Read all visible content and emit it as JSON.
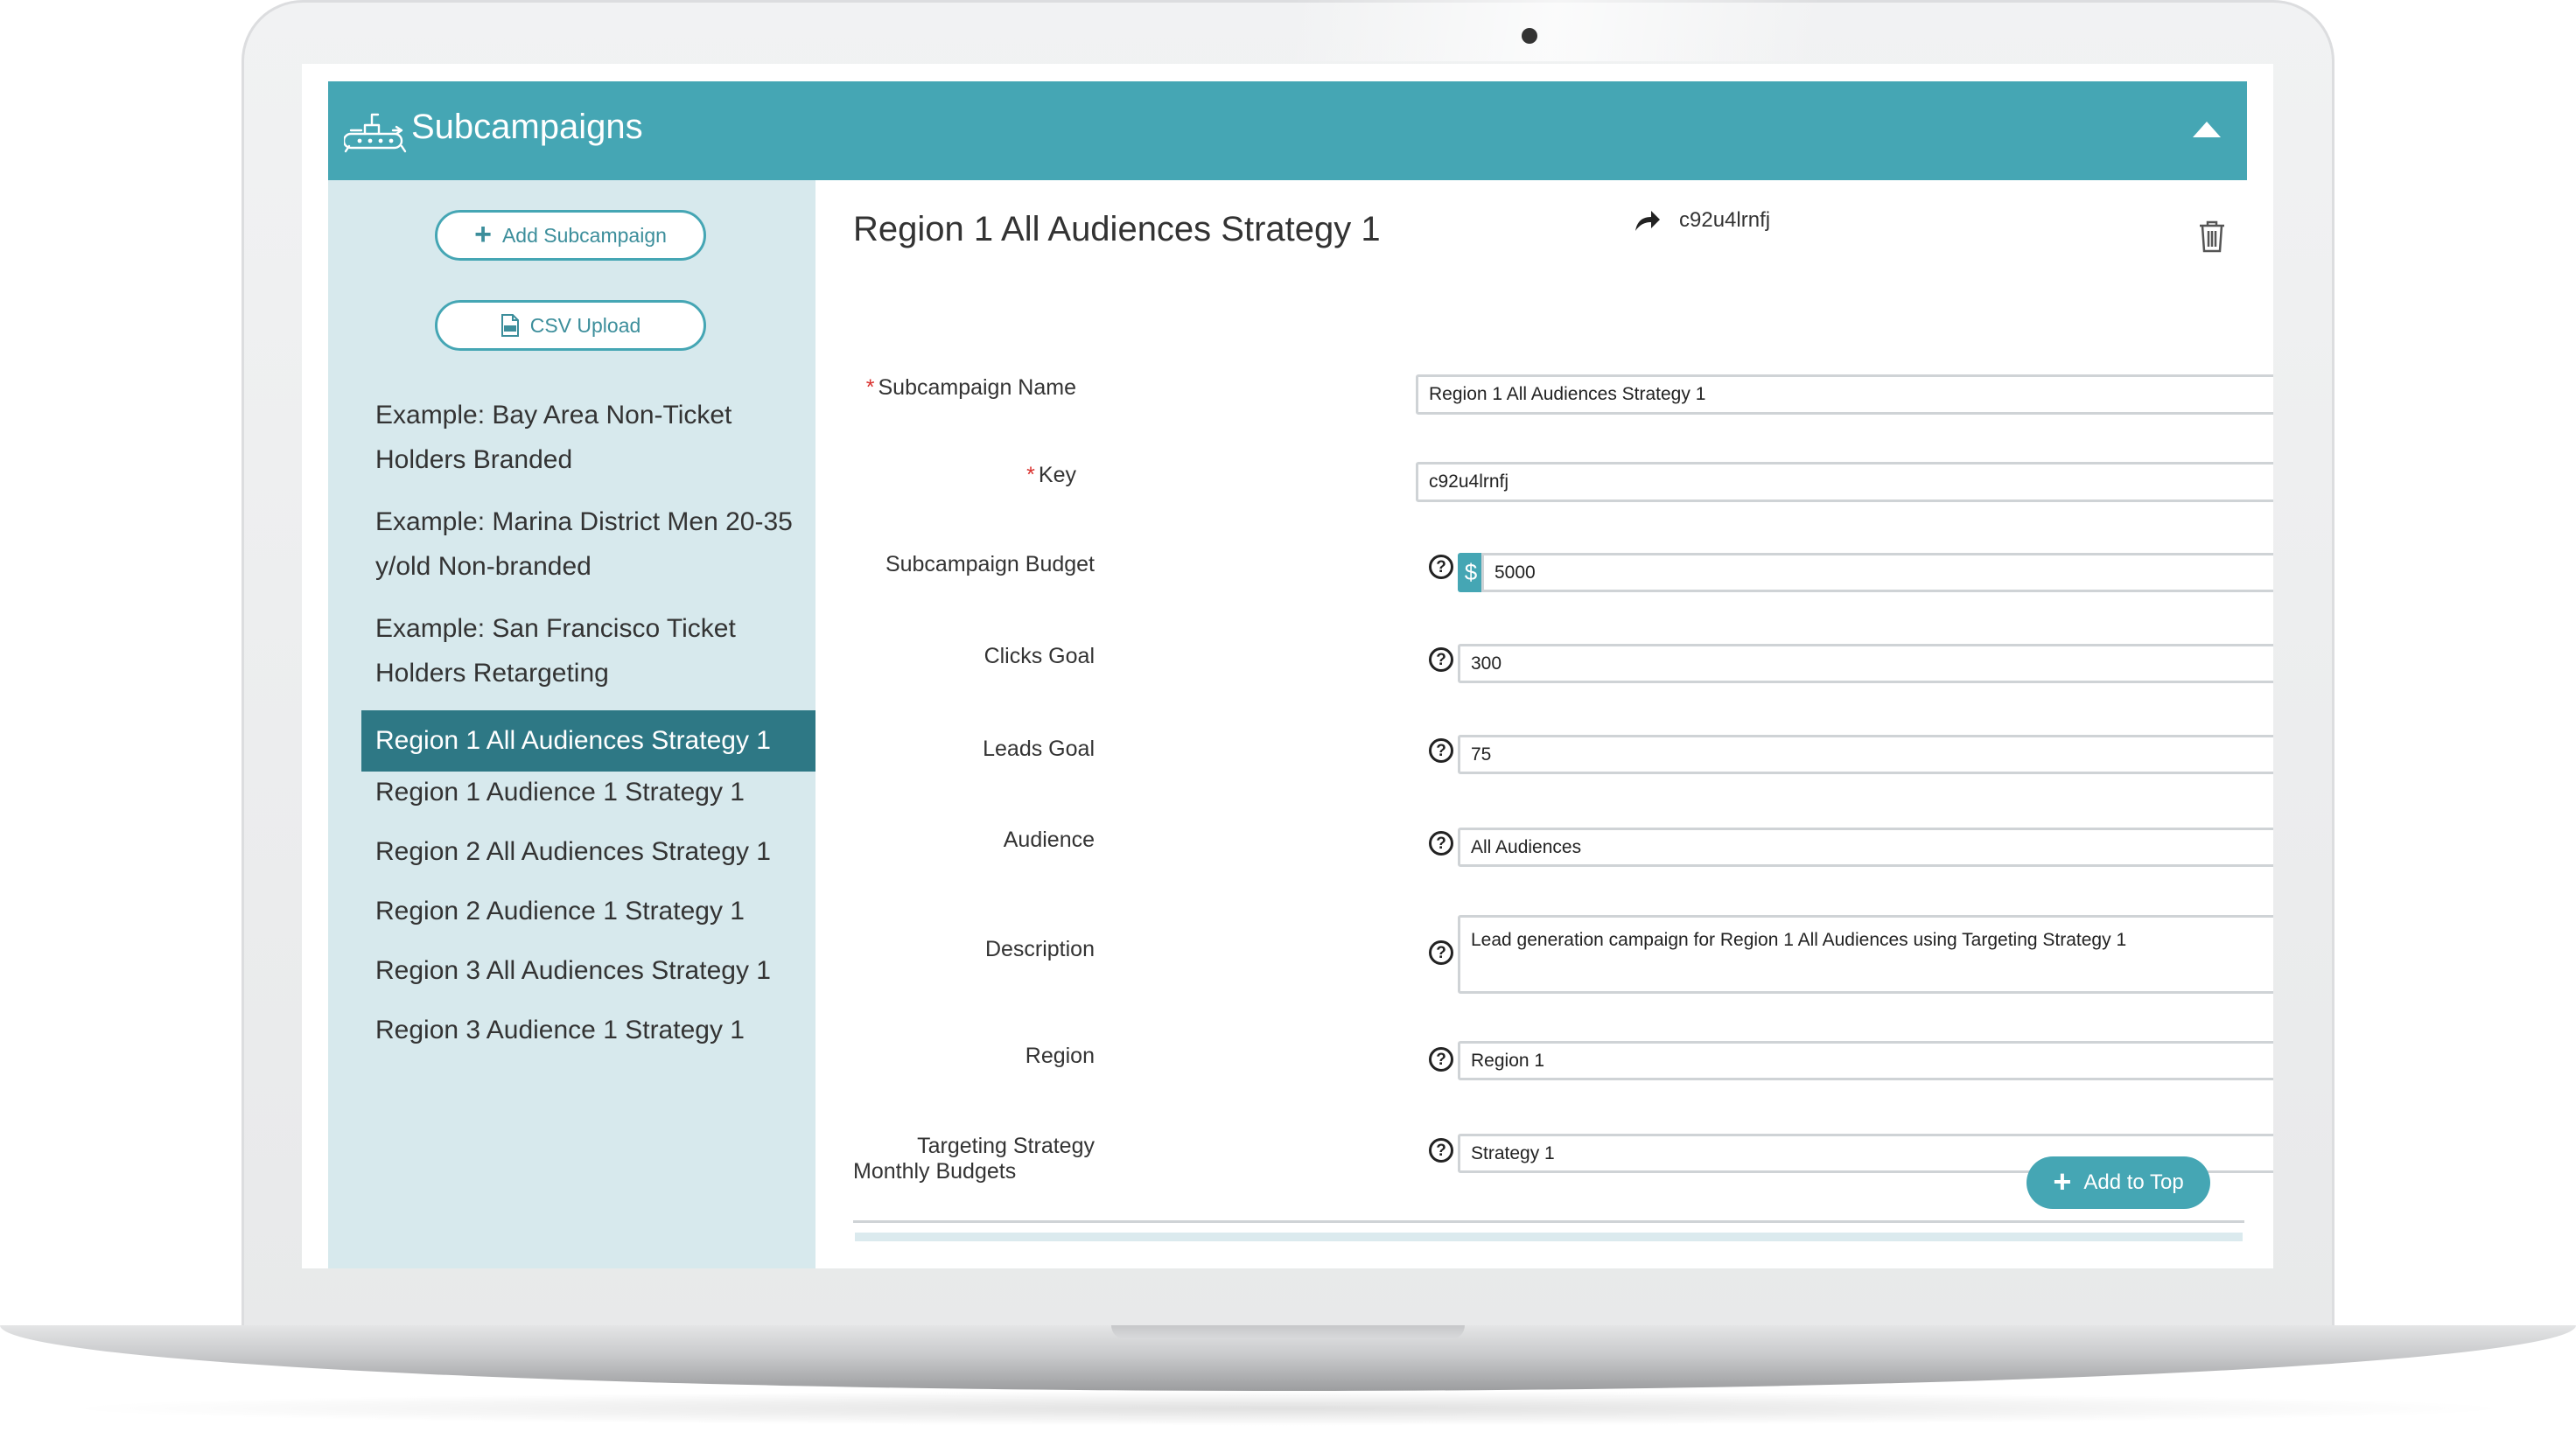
{
  "app": {
    "title": "Subcampaigns"
  },
  "sidebar": {
    "add_button_label": "Add Subcampaign",
    "csv_button_label": "CSV Upload",
    "items": [
      {
        "label": "Example: Bay Area Non-Ticket Holders Branded",
        "active": false
      },
      {
        "label": "Example: Marina District Men 20-35 y/old Non-branded",
        "active": false
      },
      {
        "label": "Example: San Francisco Ticket Holders Retargeting",
        "active": false
      },
      {
        "label": "Region 1 All Audiences Strategy 1",
        "active": true
      },
      {
        "label": "Region 1 Audience 1 Strategy 1",
        "active": false
      },
      {
        "label": "Region 2 All Audiences Strategy 1",
        "active": false
      },
      {
        "label": "Region 2 Audience 1 Strategy 1",
        "active": false
      },
      {
        "label": "Region 3 All Audiences Strategy 1",
        "active": false
      },
      {
        "label": "Region 3 Audience 1 Strategy 1",
        "active": false
      }
    ]
  },
  "detail": {
    "title": "Region 1 All Audiences Strategy 1",
    "key_display": "c92u4lrnfj",
    "form": {
      "subcampaign_name": {
        "label": "Subcampaign Name",
        "required_mark": "*",
        "value": "Region 1 All Audiences Strategy 1"
      },
      "key": {
        "label": "Key",
        "required_mark": "*",
        "value": "c92u4lrnfj"
      },
      "budget": {
        "label": "Subcampaign Budget",
        "currency": "$",
        "value": "5000"
      },
      "clicks_goal": {
        "label": "Clicks Goal",
        "value": "300"
      },
      "leads_goal": {
        "label": "Leads Goal",
        "value": "75"
      },
      "audience": {
        "label": "Audience",
        "value": "All Audiences"
      },
      "description": {
        "label": "Description",
        "value": "Lead generation campaign for Region 1 All Audiences using Targeting Strategy 1"
      },
      "region": {
        "label": "Region",
        "value": "Region 1"
      },
      "targeting_strategy": {
        "label": "Targeting Strategy",
        "value": "Strategy 1"
      }
    },
    "help_glyph": "?",
    "monthly_budgets": {
      "title": "Monthly Budgets",
      "add_button_label": "Add to Top"
    }
  },
  "colors": {
    "accent": "#45a6b4",
    "accent_dark": "#2e7885",
    "sidebar_bg": "#d7e9ed",
    "required": "#d9322f"
  },
  "icons": {
    "logo": "submarine-icon",
    "collapse": "chevron-up-icon",
    "share": "share-icon",
    "delete": "trash-icon",
    "csv": "csv-file-icon",
    "help": "help-circle-icon",
    "dropdown": "caret-down-icon"
  }
}
